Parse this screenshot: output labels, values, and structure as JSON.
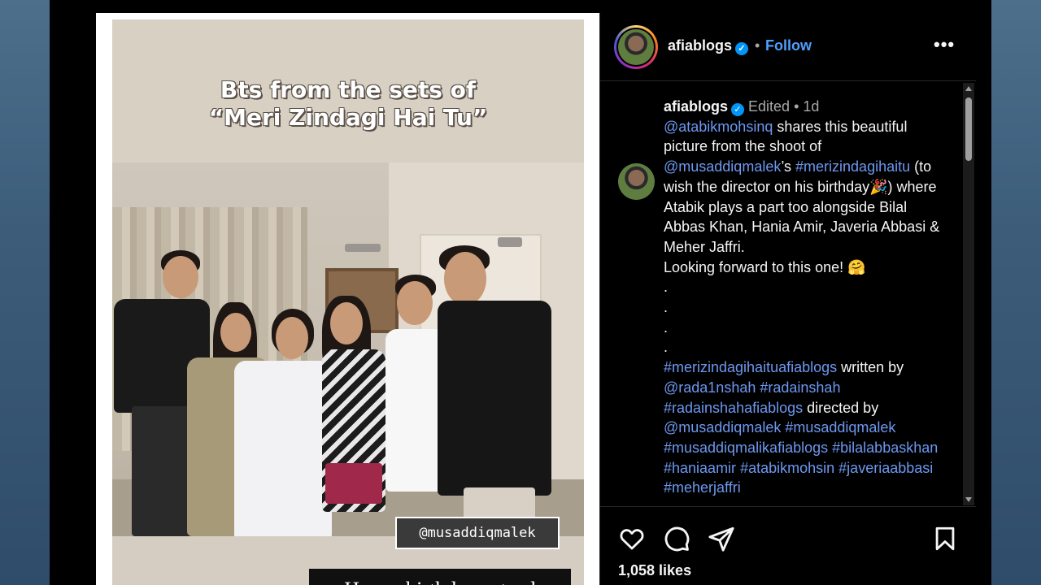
{
  "story": {
    "title_line1": "Bts from the sets of",
    "title_line2": "“Meri Zindagi Hai Tu”",
    "tag": "@musaddiqmalek",
    "caption": "Happy birthday ustaad"
  },
  "header": {
    "username": "afiablogs",
    "separator": "•",
    "follow_label": "Follow",
    "more_label": "•••"
  },
  "caption": {
    "username": "afiablogs",
    "edited": "Edited",
    "time": "1d",
    "mention1": "@atabikmohsinq",
    "text1": " shares this beautiful picture from the shoot of ",
    "mention2": "@musaddiqmalek",
    "text2": "’s ",
    "hashtag1": "#merizindagihaitu",
    "text3": " (to wish the director on his birthday🎉) where Atabik plays a part too alongside Bilal Abbas Khan, Hania Amir, Javeria Abbasi & Meher Jaffri.",
    "text4": "Looking forward to this one! 🤗",
    "dots": [
      ".",
      ".",
      ".",
      "."
    ],
    "hashtag2": "#merizindagihaituafiablogs",
    "text5": " written by ",
    "mention3": "@rada1nshah",
    "hashtag3": "#radainshah",
    "hashtag4": "#radainshahafiablogs",
    "text6": " directed by ",
    "mention4": "@musaddiqmalek",
    "hashtag5": "#musaddiqmalek",
    "hashtag6": "#musaddiqmalikafiablogs",
    "hashtag7": "#bilalabbaskhan",
    "hashtag8": "#haniaamir",
    "hashtag9": "#atabikmohsin",
    "hashtag10": "#javeriaabbasi",
    "hashtag11": "#meherjaffri"
  },
  "actions": {
    "likes": "1,058 likes"
  },
  "icons": [
    "heart-icon",
    "comment-icon",
    "share-icon",
    "bookmark-icon",
    "verified-icon",
    "more-icon"
  ],
  "colors": {
    "link": "#6c98f0",
    "follow": "#4e9fff",
    "verified": "#0095f6",
    "panel_bg": "#000000"
  }
}
